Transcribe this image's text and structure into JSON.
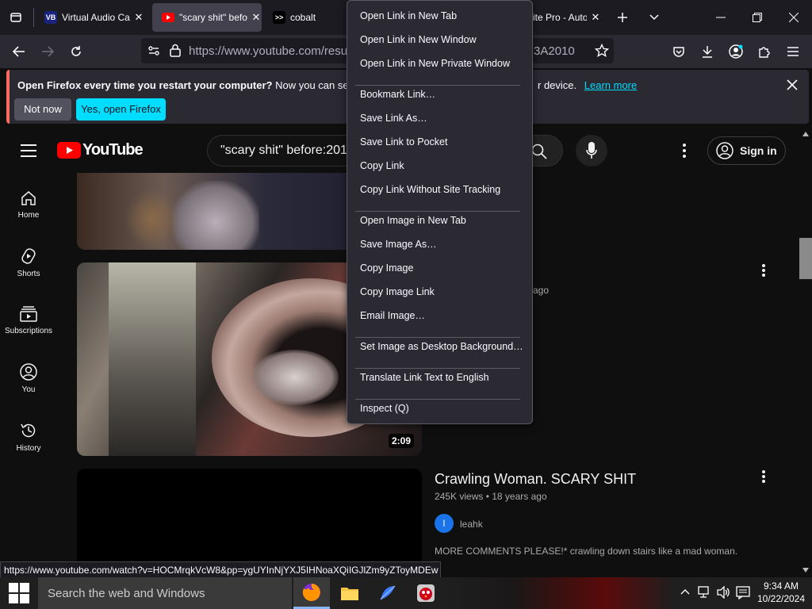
{
  "browser": {
    "tabs": [
      {
        "title": "Virtual Audio Ca",
        "favicon": "VB"
      },
      {
        "title": "\"scary shit\" befo",
        "favicon": "youtube"
      },
      {
        "title": "cobalt",
        "favicon": ">>"
      },
      {
        "title": "ite Pro - Auto",
        "favicon": ""
      }
    ],
    "url": "https://www.youtube.com/result",
    "url_tail": "3A2010"
  },
  "notification": {
    "bold": "Open Firefox every time you restart your computer?",
    "text": " Now you can set Firefox",
    "text_tail": "r device.",
    "learn_more": "Learn more",
    "not_now": "Not now",
    "yes": "Yes, open Firefox"
  },
  "youtube": {
    "logo_text": "YouTube",
    "search_query": "\"scary shit\" before:201",
    "sign_in": "Sign in",
    "sidebar": [
      {
        "label": "Home",
        "icon": "home-icon"
      },
      {
        "label": "Shorts",
        "icon": "shorts-icon"
      },
      {
        "label": "Subscriptions",
        "icon": "subscriptions-icon"
      },
      {
        "label": "You",
        "icon": "you-icon"
      },
      {
        "label": "History",
        "icon": "history-icon"
      }
    ],
    "video1": {
      "duration": "2:09",
      "meta_tail": "ago"
    },
    "video2": {
      "title": "Crawling Woman. SCARY SHIT",
      "meta": "245K views • 18 years ago",
      "channel": "leahk",
      "channel_initial": "l",
      "description": "MORE COMMENTS PLEASE!* crawling down stairs like a mad woman."
    }
  },
  "context_menu": {
    "groups": [
      [
        "Open Link in New Tab",
        "Open Link in New Window",
        "Open Link in New Private Window"
      ],
      [
        "Bookmark Link…",
        "Save Link As…",
        "Save Link to Pocket",
        "Copy Link",
        "Copy Link Without Site Tracking"
      ],
      [
        "Open Image in New Tab",
        "Save Image As…",
        "Copy Image",
        "Copy Image Link",
        "Email Image…"
      ],
      [
        "Set Image as Desktop Background…"
      ],
      [
        "Translate Link Text to English"
      ],
      [
        "Inspect (Q)"
      ]
    ]
  },
  "status_url": "https://www.youtube.com/watch?v=HOCMrqkVcW8&pp=ygUYInNjYXJ5IHNoaXQiIGJlZm9yZToyMDEw",
  "taskbar": {
    "search_placeholder": "Search the web and Windows",
    "time": "9:34 AM",
    "date": "10/22/2024"
  },
  "colors": {
    "accent_red": "#ff0000",
    "firefox_blue": "#00ddff",
    "link_blue": "#00ddff"
  }
}
